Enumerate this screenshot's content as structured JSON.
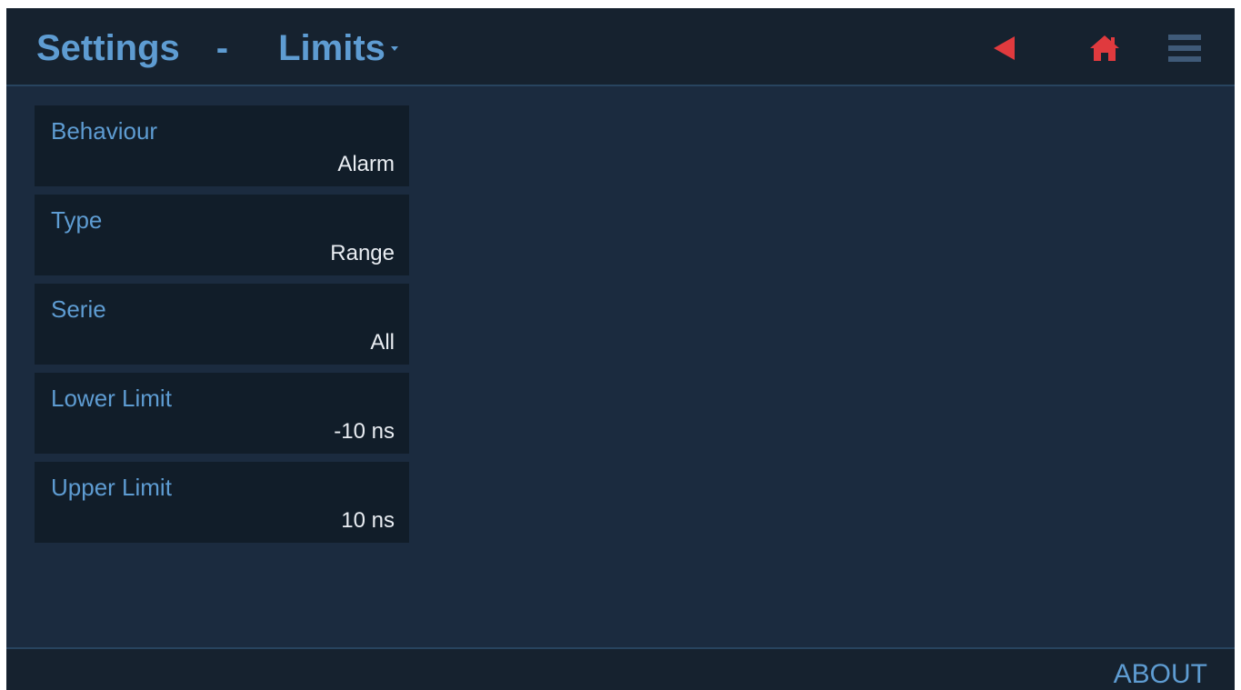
{
  "header": {
    "title": "Settings",
    "separator": "-",
    "section": "Limits",
    "icons": {
      "back": "back-triangle-icon",
      "home": "home-icon",
      "menu": "hamburger-menu-icon"
    },
    "colors": {
      "accent": "#5e9cd2",
      "alert": "#e03a3e"
    }
  },
  "settings": {
    "items": [
      {
        "label": "Behaviour",
        "value": "Alarm"
      },
      {
        "label": "Type",
        "value": "Range"
      },
      {
        "label": "Serie",
        "value": "All"
      },
      {
        "label": "Lower Limit",
        "value": "-10 ns"
      },
      {
        "label": "Upper Limit",
        "value": "10 ns"
      }
    ]
  },
  "footer": {
    "about_label": "ABOUT"
  }
}
